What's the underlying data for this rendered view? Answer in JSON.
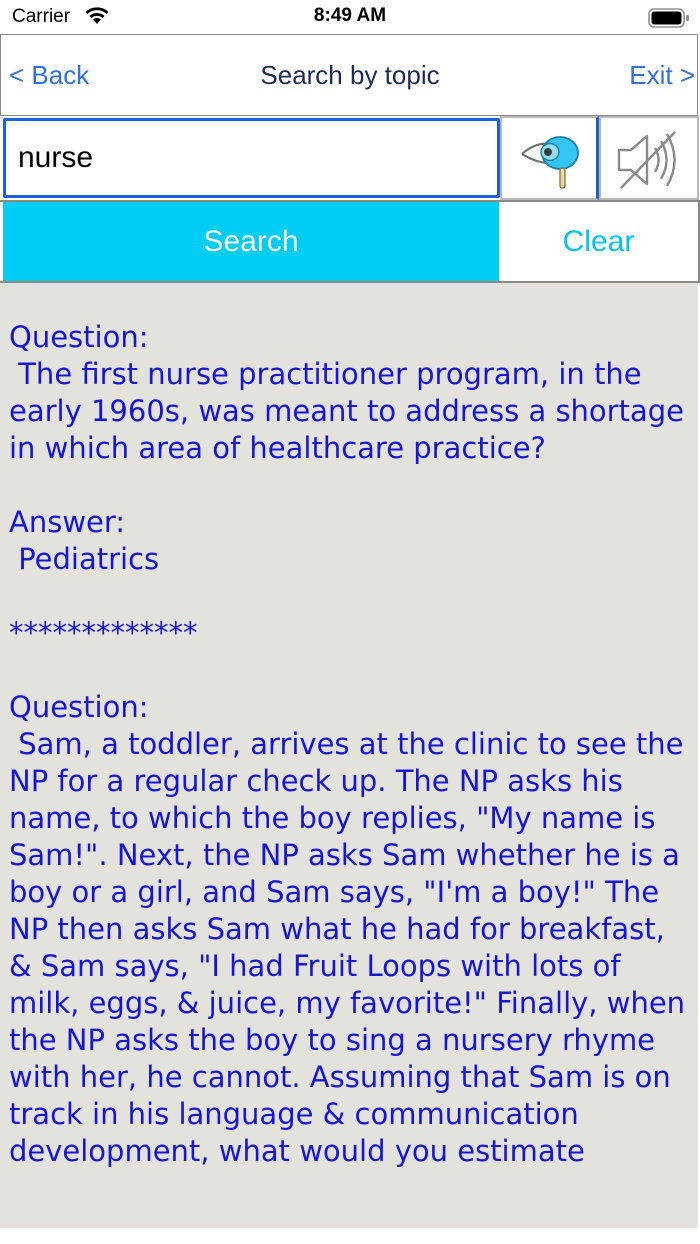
{
  "status_bar": {
    "carrier": "Carrier",
    "time": "8:49 AM",
    "wifi_icon": "wifi-icon",
    "battery_icon": "battery-icon"
  },
  "nav": {
    "back_label": "< Back",
    "title": "Search by topic",
    "exit_label": "Exit >"
  },
  "search": {
    "value": "nurse",
    "voice_icon": "microphone-icon",
    "mute_icon": "speaker-muted-icon",
    "search_label": "Search",
    "clear_label": "Clear"
  },
  "colors": {
    "accent": "#00cdf5",
    "link": "#2f6fe0",
    "result_text": "#1515d8",
    "result_bg": "#e3e2dc"
  },
  "results": {
    "text": "Question:\n The first nurse practitioner program, in the early 1960s, was meant to address a shortage in which area of healthcare practice?\n\nAnswer:\n Pediatrics\n\n*************\n\nQuestion:\n Sam, a toddler, arrives at the clinic to see the NP for a regular check up. The NP asks his name, to which the boy replies, \"My name is Sam!\". Next, the NP asks Sam whether he is a boy or a girl, and Sam says, \"I'm a boy!\" The NP then asks Sam what he had for breakfast, & Sam says, \"I had Fruit Loops with lots of milk, eggs, & juice, my favorite!\" Finally, when the NP asks the boy to sing a nursery rhyme with her, he cannot. Assuming that Sam is on track in his language & communication development, what would you estimate"
  }
}
